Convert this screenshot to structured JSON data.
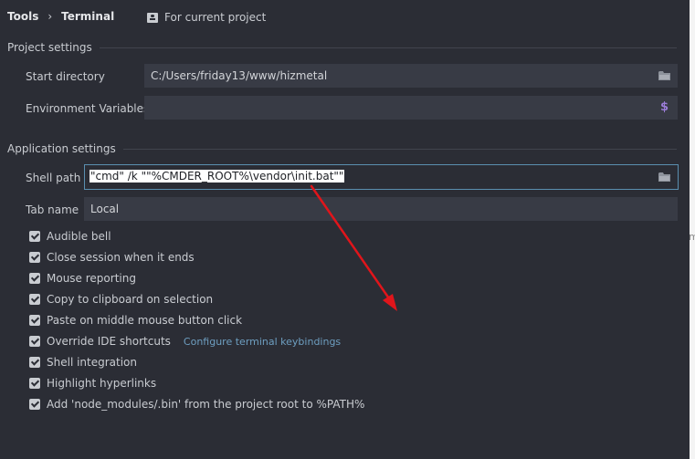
{
  "breadcrumb": {
    "parent": "Tools",
    "separator": "›",
    "current": "Terminal"
  },
  "scope": {
    "label": "For current project",
    "icon": "project-scope-icon"
  },
  "project_settings": {
    "heading": "Project settings",
    "start_directory": {
      "label": "Start directory",
      "value": "C:/Users/friday13/www/hizmetal"
    },
    "environment_variables": {
      "label": "Environment Variables",
      "value": "",
      "icon_text": "$"
    }
  },
  "application_settings": {
    "heading": "Application settings",
    "shell_path": {
      "label": "Shell path",
      "value": "\"cmd\" /k \"\"%CMDER_ROOT%\\vendor\\init.bat\"\""
    },
    "tab_name": {
      "label": "Tab name",
      "value": "Local"
    },
    "options": [
      {
        "label": "Audible bell",
        "checked": true
      },
      {
        "label": "Close session when it ends",
        "checked": true
      },
      {
        "label": "Mouse reporting",
        "checked": true
      },
      {
        "label": "Copy to clipboard on selection",
        "checked": true
      },
      {
        "label": "Paste on middle mouse button click",
        "checked": true
      },
      {
        "label": "Override IDE shortcuts",
        "checked": true,
        "link": "Configure terminal keybindings"
      },
      {
        "label": "Shell integration",
        "checked": true
      },
      {
        "label": "Highlight hyperlinks",
        "checked": true
      },
      {
        "label": "Add 'node_modules/.bin' from the project root to %PATH%",
        "checked": true
      }
    ]
  },
  "edge_fragment": "m",
  "colors": {
    "background": "#2b2d35",
    "field": "#383b45",
    "focus_border": "#5a8fb0",
    "link": "#6e9fc1",
    "arrow": "#e0151b",
    "env_icon": "#9b7dd8"
  }
}
